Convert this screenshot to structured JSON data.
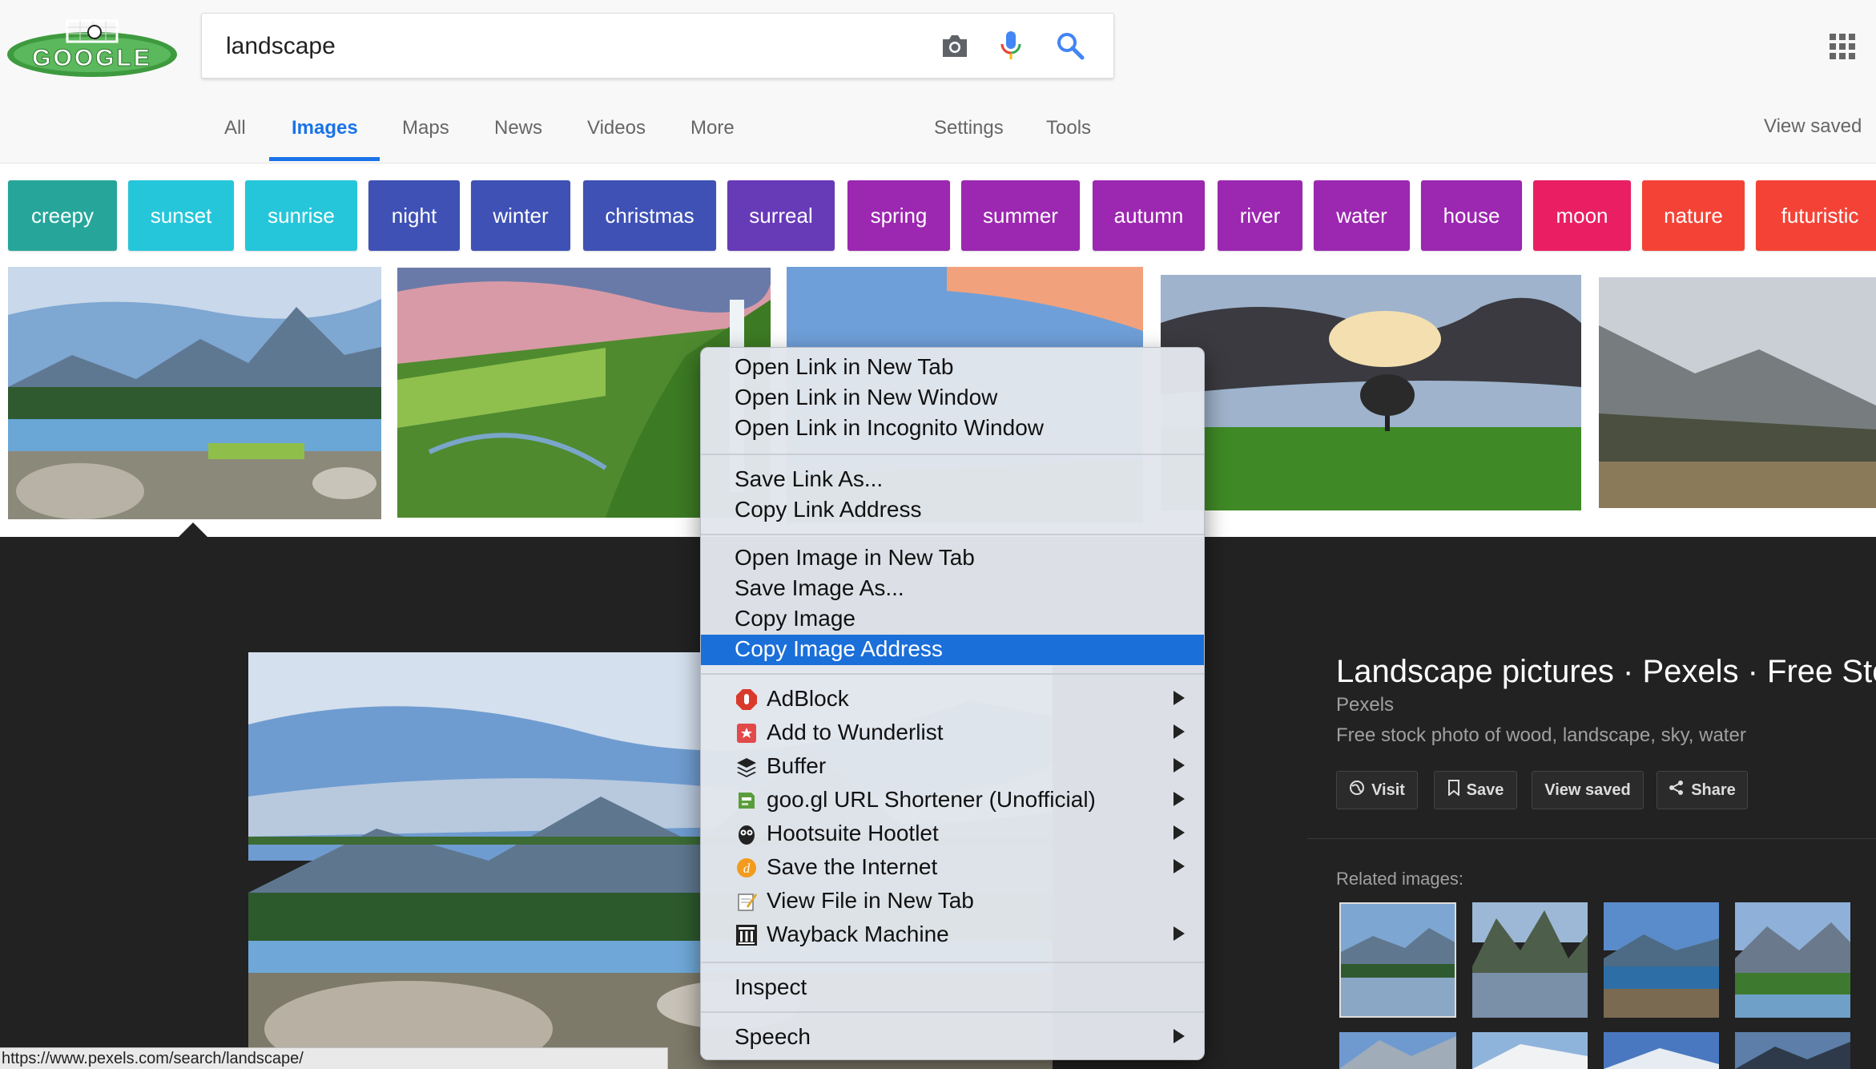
{
  "search": {
    "query": "landscape"
  },
  "tabs": [
    {
      "label": "All"
    },
    {
      "label": "Images",
      "active": true
    },
    {
      "label": "Maps"
    },
    {
      "label": "News"
    },
    {
      "label": "Videos"
    },
    {
      "label": "More"
    },
    {
      "label": "Settings"
    },
    {
      "label": "Tools"
    },
    {
      "label": "View saved"
    }
  ],
  "chips": [
    {
      "label": "creepy",
      "color": "#26a69a"
    },
    {
      "label": "sunset",
      "color": "#26c6da"
    },
    {
      "label": "sunrise",
      "color": "#26c6da"
    },
    {
      "label": "night",
      "color": "#3f51b5"
    },
    {
      "label": "winter",
      "color": "#3f51b5"
    },
    {
      "label": "christmas",
      "color": "#3f51b5"
    },
    {
      "label": "surreal",
      "color": "#673ab7"
    },
    {
      "label": "spring",
      "color": "#9c27b0"
    },
    {
      "label": "summer",
      "color": "#9c27b0"
    },
    {
      "label": "autumn",
      "color": "#9c27b0"
    },
    {
      "label": "river",
      "color": "#9c27b0"
    },
    {
      "label": "water",
      "color": "#9c27b0"
    },
    {
      "label": "house",
      "color": "#9c27b0"
    },
    {
      "label": "moon",
      "color": "#e91e63"
    },
    {
      "label": "nature",
      "color": "#f44336"
    },
    {
      "label": "futuristic",
      "color": "#f44336"
    }
  ],
  "panel": {
    "title": "Landscape pictures · Pexels · Free Sto",
    "source": "Pexels",
    "description": "Free stock photo of wood, landscape, sky, water",
    "buttons": {
      "visit": "Visit",
      "save": "Save",
      "view_saved": "View saved",
      "share": "Share"
    },
    "related_label": "Related images:"
  },
  "status_url": "https://www.pexels.com/search/landscape/",
  "context_menu": {
    "group1": [
      "Open Link in New Tab",
      "Open Link in New Window",
      "Open Link in Incognito Window"
    ],
    "group2": [
      "Save Link As...",
      "Copy Link Address"
    ],
    "group3": [
      "Open Image in New Tab",
      "Save Image As...",
      "Copy Image",
      "Copy Image Address"
    ],
    "highlighted": "Copy Image Address",
    "extensions": [
      {
        "label": "AdBlock",
        "icon": "adblock-icon",
        "submenu": true
      },
      {
        "label": "Add to Wunderlist",
        "icon": "wunderlist-icon",
        "submenu": true
      },
      {
        "label": "Buffer",
        "icon": "buffer-icon",
        "submenu": true
      },
      {
        "label": "goo.gl URL Shortener (Unofficial)",
        "icon": "googl-icon",
        "submenu": true
      },
      {
        "label": "Hootsuite Hootlet",
        "icon": "hootsuite-owl-icon",
        "submenu": true
      },
      {
        "label": "Save the Internet",
        "icon": "save-internet-icon",
        "submenu": true
      },
      {
        "label": "View File in New Tab",
        "icon": "view-file-icon",
        "submenu": false
      },
      {
        "label": "Wayback Machine",
        "icon": "wayback-icon",
        "submenu": true
      }
    ],
    "inspect": "Inspect",
    "speech": "Speech"
  }
}
